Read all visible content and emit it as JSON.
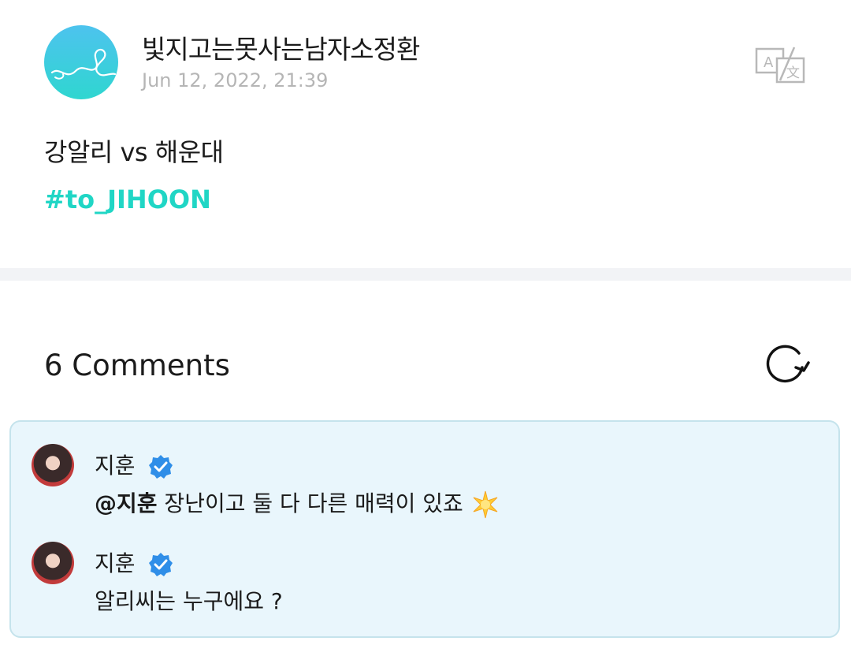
{
  "post": {
    "author": "빛지고는못사는남자소정환",
    "timestamp": "Jun 12, 2022, 21:39",
    "text": "강알리 vs 해운대",
    "hashtag": "#to_JIHOON",
    "translate_icon": "translate-icon"
  },
  "comments_section": {
    "title": "6 Comments",
    "refresh_icon": "refresh-icon",
    "items": [
      {
        "author": "지훈",
        "verified_icon": "verified-badge-icon",
        "mention": "@지훈",
        "text": " 장난이고 둘 다 다른 매력이 있죠",
        "emoji_icon": "sparkle-emoji"
      },
      {
        "author": "지훈",
        "verified_icon": "verified-badge-icon",
        "mention": "",
        "text": "알리씨는 누구에요 ?"
      }
    ]
  },
  "colors": {
    "accent": "#20d6c5",
    "comment_bg": "#e9f6fc",
    "verified": "#2f8ee8",
    "timestamp": "#b5b5b5"
  }
}
